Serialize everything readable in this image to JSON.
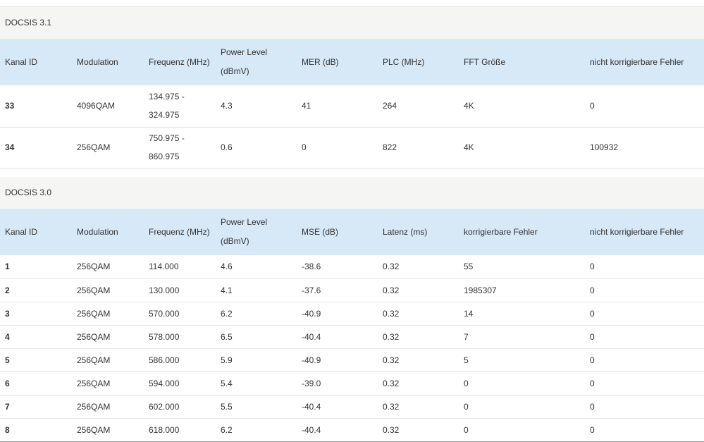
{
  "docsis31": {
    "title": "DOCSIS 3.1",
    "headers": [
      "Kanal ID",
      "Modulation",
      "Frequenz (MHz)",
      "Power Level",
      "(dBmV)",
      "MER (dB)",
      "PLC (MHz)",
      "FFT Größe",
      "nicht korrigierbare Fehler"
    ],
    "rows": [
      {
        "id": "33",
        "modulation": "4096QAM",
        "freq_start": "134.975 -",
        "freq_end": "324.975",
        "power": "4.3",
        "mer": "41",
        "plc": "264",
        "fft": "4K",
        "uncorrectable": "0"
      },
      {
        "id": "34",
        "modulation": "256QAM",
        "freq_start": "750.975 -",
        "freq_end": "860.975",
        "power": "0.6",
        "mer": "0",
        "plc": "822",
        "fft": "4K",
        "uncorrectable": "100932"
      }
    ]
  },
  "docsis30": {
    "title": "DOCSIS 3.0",
    "headers": [
      "Kanal ID",
      "Modulation",
      "Frequenz (MHz)",
      "Power Level",
      "(dBmV)",
      "MSE (dB)",
      "Latenz (ms)",
      "korrigierbare Fehler",
      "nicht korrigierbare Fehler"
    ],
    "rows": [
      {
        "id": "1",
        "modulation": "256QAM",
        "freq": "114.000",
        "power": "4.6",
        "mse": "-38.6",
        "latency": "0.32",
        "correctable": "55",
        "uncorrectable": "0"
      },
      {
        "id": "2",
        "modulation": "256QAM",
        "freq": "130.000",
        "power": "4.1",
        "mse": "-37.6",
        "latency": "0.32",
        "correctable": "1985307",
        "uncorrectable": "0"
      },
      {
        "id": "3",
        "modulation": "256QAM",
        "freq": "570.000",
        "power": "6.2",
        "mse": "-40.9",
        "latency": "0.32",
        "correctable": "14",
        "uncorrectable": "0"
      },
      {
        "id": "4",
        "modulation": "256QAM",
        "freq": "578.000",
        "power": "6.5",
        "mse": "-40.4",
        "latency": "0.32",
        "correctable": "7",
        "uncorrectable": "0"
      },
      {
        "id": "5",
        "modulation": "256QAM",
        "freq": "586.000",
        "power": "5.9",
        "mse": "-40.9",
        "latency": "0.32",
        "correctable": "5",
        "uncorrectable": "0"
      },
      {
        "id": "6",
        "modulation": "256QAM",
        "freq": "594.000",
        "power": "5.4",
        "mse": "-39.0",
        "latency": "0.32",
        "correctable": "0",
        "uncorrectable": "0"
      },
      {
        "id": "7",
        "modulation": "256QAM",
        "freq": "602.000",
        "power": "5.5",
        "mse": "-40.4",
        "latency": "0.32",
        "correctable": "0",
        "uncorrectable": "0"
      },
      {
        "id": "8",
        "modulation": "256QAM",
        "freq": "618.000",
        "power": "6.2",
        "mse": "-40.4",
        "latency": "0.32",
        "correctable": "0",
        "uncorrectable": "0"
      }
    ]
  }
}
